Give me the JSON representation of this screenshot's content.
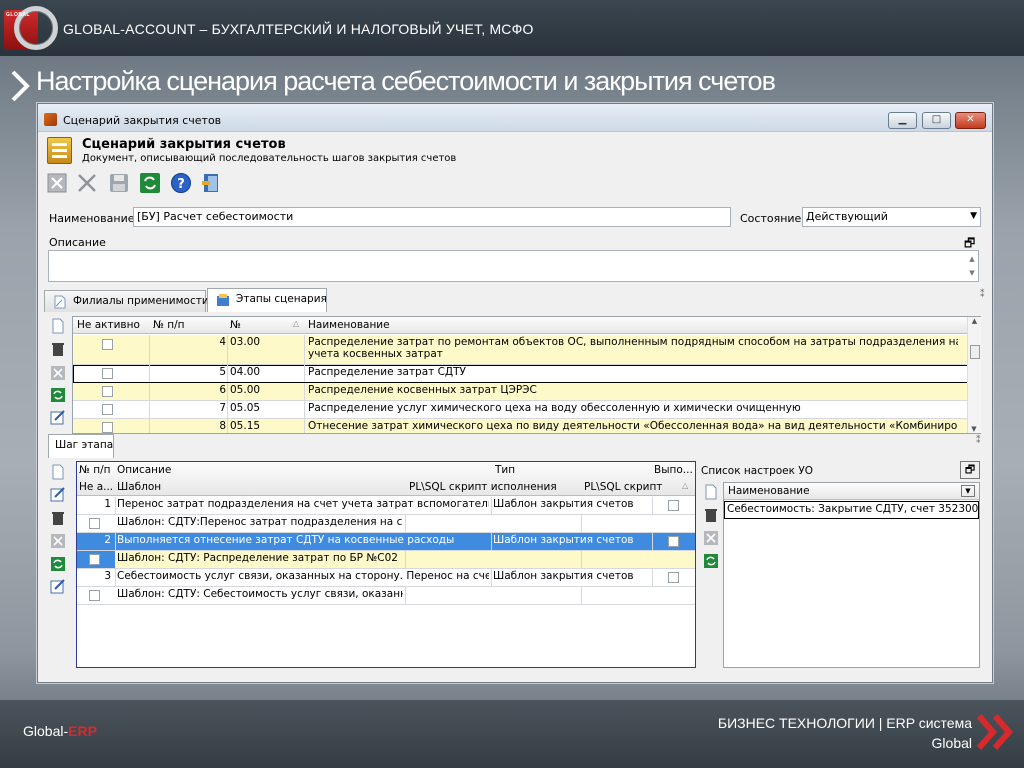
{
  "slide": {
    "brand": "GLOBAL-ACCOUNT – БУХГАЛТЕРСКИЙ И НАЛОГОВЫЙ УЧЕТ, МСФО",
    "headline": "Настройка сценария расчета себестоимости и закрытия счетов",
    "footer_left_prefix": "Global-",
    "footer_left_accent": "ERP",
    "footer_right_line1": "БИЗНЕС ТЕХНОЛОГИИ | ERP система",
    "footer_right_line2": "Global",
    "accent_color": "#d8292c"
  },
  "window": {
    "title": "Сценарий закрытия счетов",
    "controls": {
      "minimize": "▁",
      "maximize": "□",
      "close": "✕"
    }
  },
  "header": {
    "title": "Сценарий закрытия счетов",
    "subtitle": "Документ, описывающий последовательность шагов закрытия счетов"
  },
  "toolbar": {
    "items": [
      {
        "name": "cancel-edit-icon"
      },
      {
        "name": "delete-icon"
      },
      {
        "name": "save-icon"
      },
      {
        "name": "refresh-icon"
      },
      {
        "name": "help-icon"
      },
      {
        "name": "exit-icon"
      }
    ]
  },
  "form": {
    "name_label": "Наименование",
    "name_value": "[БУ] Расчет себестоимости",
    "state_label": "Состояние",
    "state_value": "Действующий",
    "description_label": "Описание",
    "description_value": ""
  },
  "tabs": {
    "branches": "Филиалы применимости",
    "stages": "Этапы сценария",
    "step": "Шаг этапа"
  },
  "stages_grid": {
    "columns": {
      "inactive": "Не активно",
      "seq": "№ п/п",
      "num": "№",
      "name": "Наименование"
    },
    "rows": [
      {
        "seq": "4",
        "num": "03.00",
        "name1": "Распределение затрат по ремонтам объектов ОС, выполненным подрядным способом на затраты подразделения на счет",
        "name2": "учета косвенных затрат"
      },
      {
        "seq": "5",
        "num": "04.00",
        "name1": "Распределение затрат СДТУ",
        "name2": ""
      },
      {
        "seq": "6",
        "num": "05.00",
        "name1": "Распределение косвенных затрат ЦЭРЭС",
        "name2": ""
      },
      {
        "seq": "7",
        "num": "05.05",
        "name1": "Распределение услуг химического цеха на воду обессоленную и химически очищенную",
        "name2": ""
      },
      {
        "seq": "8",
        "num": "05.15",
        "name1": "Отнесение затрат химического цеха по виду деятельности «Обессоленная вода» на вид деятельности «Комбинированная",
        "name2": ""
      }
    ]
  },
  "steps_grid": {
    "columns": {
      "seq": "№ п/п",
      "desc": "Описание",
      "type": "Тип",
      "exec": "Выпо...",
      "inactive": "Не а...",
      "template": "Шаблон",
      "plsql_exec": "PL\\SQL скрипт исполнения",
      "plsql2": "PL\\SQL скрипт ..."
    },
    "rows": [
      {
        "seq": "1",
        "desc": "Перенос затрат подразделения на счет учета затрат вспомогательного",
        "type": "Шаблон закрытия счетов",
        "template": "Шаблон: СДТУ:Перенос затрат подразделения на счет"
      },
      {
        "seq": "2",
        "desc": "Выполняется отнесение затрат СДТУ на косвенные расходы",
        "type": "Шаблон закрытия счетов",
        "template": "Шаблон: СДТУ: Распределение затрат по БР №С02"
      },
      {
        "seq": "3",
        "desc": "Себестоимость услуг связи, оказанных на сторону. Перенос на счет",
        "type": "Шаблон закрытия счетов",
        "template": "Шаблон: СДТУ: Себестоимость услуг связи, оказанн..."
      }
    ]
  },
  "settings_panel": {
    "title": "Список настроек УО",
    "column": "Наименование",
    "rows": [
      "Себестоимость: Закрытие СДТУ, счет 352300"
    ]
  }
}
